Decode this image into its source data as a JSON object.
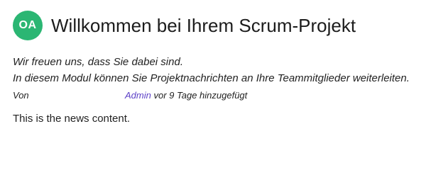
{
  "news": {
    "avatar_initials": "OA",
    "avatar_color": "#2bb673",
    "title": "Willkommen bei Ihrem Scrum-Projekt",
    "intro_line_1": "Wir freuen uns, dass Sie dabei sind.",
    "intro_line_2": "In diesem Modul können Sie Projektnachrichten an Ihre Teammitglieder weiterleiten.",
    "by_label": "Von",
    "author": "Admin",
    "timestamp": "vor 9 Tage hinzugefügt",
    "content": "This is the news content."
  },
  "colors": {
    "link": "#5b3fc7"
  }
}
